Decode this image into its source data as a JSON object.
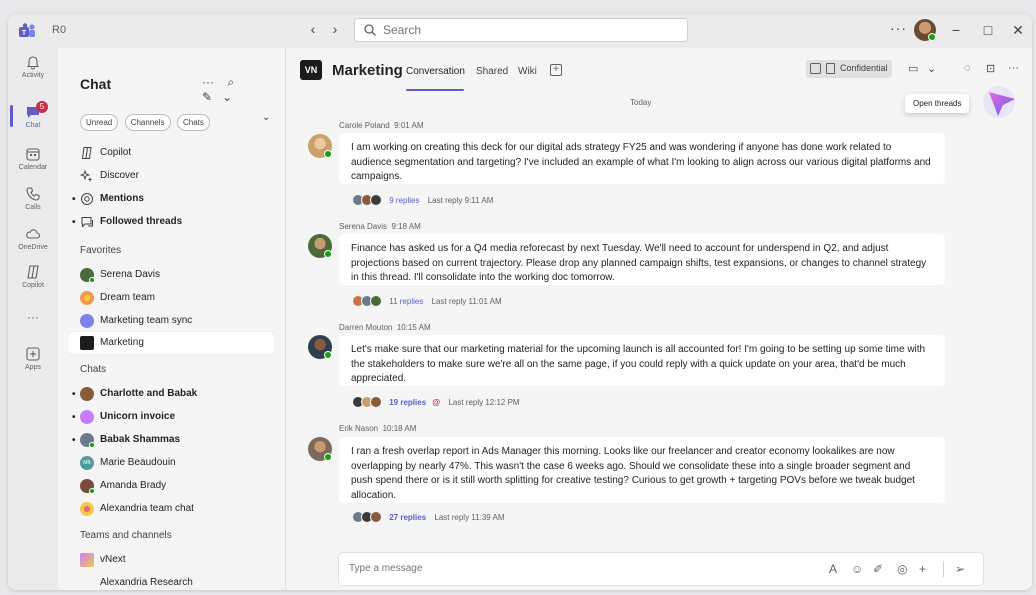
{
  "titlebar": {
    "user_initials": "R0",
    "back_icon": "‹",
    "forward_icon": "›",
    "search_placeholder": "Search",
    "more_icon": "···",
    "minimize": "−",
    "maximize": "□",
    "close": "✕"
  },
  "rail": {
    "items": [
      {
        "label": "Activity",
        "icon": "bell-icon"
      },
      {
        "label": "Chat",
        "icon": "chat-icon",
        "badge": "5"
      },
      {
        "label": "Calendar",
        "icon": "calendar-icon"
      },
      {
        "label": "Calls",
        "icon": "phone-icon"
      },
      {
        "label": "OneDrive",
        "icon": "cloud-icon"
      },
      {
        "label": "Copilot",
        "icon": "copilot-icon"
      },
      {
        "label": "···",
        "icon": "more-icon"
      },
      {
        "label": "Apps",
        "icon": "apps-icon"
      }
    ]
  },
  "pane": {
    "title": "Chat",
    "more_icon": "···",
    "search_icon": "⌕",
    "compose_icon": "✎",
    "chevron": "⌄",
    "filters": [
      "Unread",
      "Channels",
      "Chats"
    ],
    "filter_chevron": "⌄",
    "top_items": [
      {
        "label": "Copilot",
        "bold": false,
        "dot": ""
      },
      {
        "label": "Discover",
        "bold": false,
        "dot": ""
      },
      {
        "label": "Mentions",
        "bold": true,
        "dot": "•"
      },
      {
        "label": "Followed threads",
        "bold": true,
        "dot": "•"
      }
    ],
    "favorites_header": "Favorites",
    "favorites": [
      {
        "label": "Serena Davis",
        "color": "#4a6a3a"
      },
      {
        "label": "Dream team",
        "color": "#f2994a"
      },
      {
        "label": "Marketing team sync",
        "color": "#7b83eb"
      },
      {
        "label": "Marketing",
        "color": "#1b1b1b"
      }
    ],
    "chats_header": "Chats",
    "chats": [
      {
        "label": "Charlotte and Babak",
        "bold": true,
        "dot": "•",
        "color": "#8a5a3c"
      },
      {
        "label": "Unicorn invoice",
        "bold": true,
        "dot": "•",
        "color": "#c77dff"
      },
      {
        "label": "Babak Shammas",
        "bold": true,
        "dot": "•",
        "color": "#6b7b8c"
      },
      {
        "label": "Marie Beaudouin",
        "bold": false,
        "dot": "",
        "color": "#4f9d9a",
        "initials": "MB"
      },
      {
        "label": "Amanda Brady",
        "bold": false,
        "dot": "",
        "color": "#7a4b3a"
      },
      {
        "label": "Alexandria team chat",
        "bold": false,
        "dot": "",
        "color": "#f2c94c"
      }
    ],
    "teams_header": "Teams and channels",
    "teams": [
      {
        "label": "vNext",
        "color": "#c77dff"
      },
      {
        "label": "Alexandria Research",
        "color": ""
      }
    ]
  },
  "main": {
    "team_logo_text": "VN",
    "team_name": "Marketing",
    "tabs": [
      "Conversation",
      "Shared",
      "Wiki"
    ],
    "add_tab": "+",
    "confidential_label": "Confidential",
    "video_icon": "▭",
    "chev": "⌄",
    "threads_icon": "◌",
    "share_icon": "⊡",
    "more_icon": "···",
    "tooltip": "Open threads",
    "today_label": "Today",
    "messages": [
      {
        "author": "Carole Poland",
        "time": "9:01 AM",
        "text": "I am working on creating this deck for our digital ads strategy FY25 and was wondering if anyone has done work related to audience segmentation and targeting? I've included an example of what I'm looking to align across our various digital platforms and campaigns.",
        "replies": "9 replies",
        "last_reply": "Last reply 9:11 AM",
        "mention": "",
        "bold_replies": false
      },
      {
        "author": "Serena Davis",
        "time": "9:18 AM",
        "text": "Finance has asked us for a Q4 media reforecast by next Tuesday. We'll need to account for underspend in Q2, and adjust projections based on current trajectory. Please drop any planned campaign shifts, test expansions, or changes to channel strategy in this thread. I'll consolidate into the working doc tomorrow.",
        "replies": "11 replies",
        "last_reply": "Last reply 11:01 AM",
        "mention": "",
        "bold_replies": false
      },
      {
        "author": "Darren Mouton",
        "time": "10:15 AM",
        "text": "Let's make sure that our marketing material for the upcoming launch is all accounted for! I'm going to be setting up some time with the stakeholders to make sure we're all on the same page, if you could reply with a quick update on your area, that'd be much appreciated.",
        "replies": "19 replies",
        "last_reply": "Last reply 12:12 PM",
        "mention": "@",
        "bold_replies": true
      },
      {
        "author": "Erik Nason",
        "time": "10:18 AM",
        "text": "I ran a fresh overlap report in Ads Manager this morning. Looks like our freelancer and creator economy lookalikes are now overlapping by nearly 47%. This wasn't the case 6 weeks ago. Should we consolidate these into a single broader segment and push spend there or is it still worth splitting for creative testing? Curious to get growth + targeting POVs before we tweak budget allocation.",
        "replies": "27 replies",
        "last_reply": "Last reply 11:39 AM",
        "mention": "",
        "bold_replies": true
      }
    ],
    "compose_placeholder": "Type a message",
    "compose_icons": [
      "A",
      "☺",
      "✐",
      "◎",
      "+",
      "➢"
    ]
  },
  "colors": {
    "accent": "#5b5fc7",
    "badge": "#c4314b",
    "presence": "#13a10e"
  }
}
